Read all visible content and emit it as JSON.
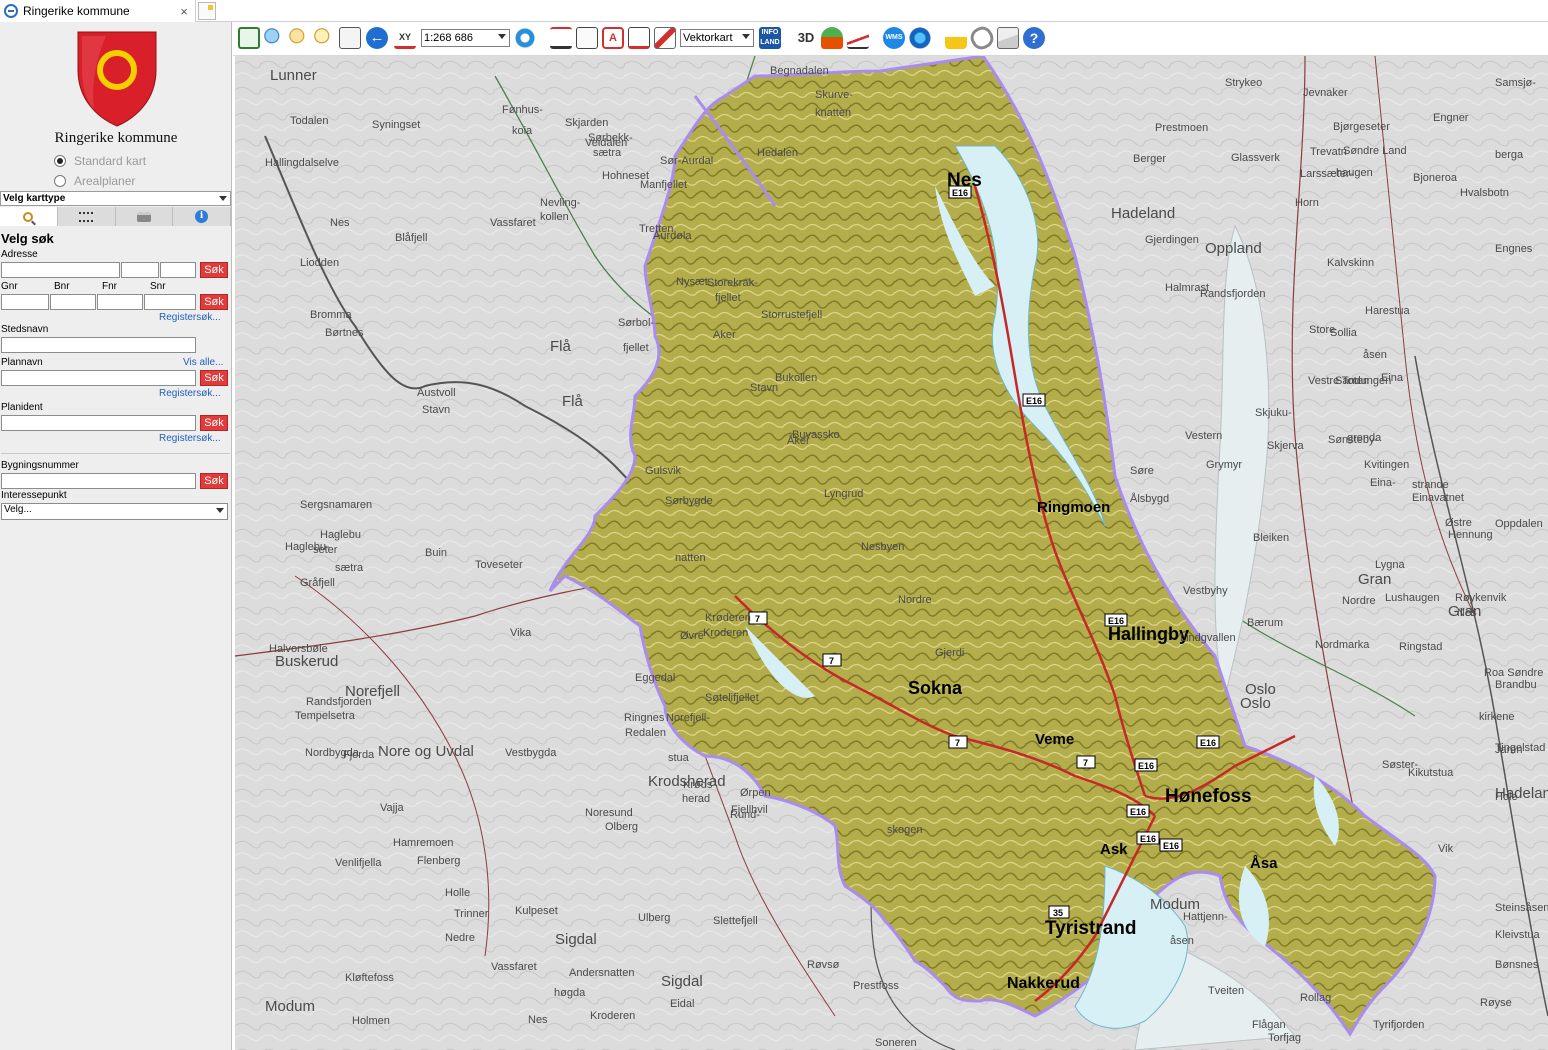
{
  "browser": {
    "tab_title": "Ringerike kommune",
    "tab_close": "×",
    "tab_icon": "ie-page-icon",
    "newtab_icon": "new-tab-icon"
  },
  "sidebar": {
    "municipality_name": "Ringerike kommune",
    "map_modes": [
      {
        "label": "Standard kart",
        "selected": true
      },
      {
        "label": "Arealplaner",
        "selected": false
      }
    ],
    "map_type_select": "Velg karttype",
    "tool_tabs": [
      "search-icon",
      "layers-icon",
      "print-icon",
      "info-icon"
    ],
    "search": {
      "heading": "Velg søk",
      "address_label": "Adresse",
      "search_button": "Søk",
      "gnr_label": "Gnr",
      "bnr_label": "Bnr",
      "fnr_label": "Fnr",
      "snr_label": "Snr",
      "register_link": "Registersøk...",
      "place_label": "Stedsnavn",
      "plan_label": "Plannavn",
      "show_all_link": "Vis alle...",
      "planident_label": "Planident",
      "building_label": "Bygningsnummer",
      "poi_label": "Interessepunkt",
      "poi_select": "Velg..."
    }
  },
  "toolbar": {
    "scale": "1:268 686",
    "map_type": "Vektorkart",
    "icons": [
      "zoom-extent-icon",
      "zoom-in-icon",
      "zoom-out-icon",
      "zoom-search-icon",
      "select-area-icon",
      "back-icon",
      "coordinate-icon",
      "refresh-icon",
      "measure-icon",
      "buildings-icon",
      "address-icon",
      "property-icon",
      "draw-icon",
      "info-land-icon",
      "3d-icon",
      "poi-icon",
      "profile-icon",
      "wms-icon",
      "globe-icon",
      "lock-icon",
      "link-icon",
      "mail-icon",
      "help-icon"
    ],
    "xy_label": "XY",
    "infoland_label": "INFO LAND",
    "wms_label": "WMS",
    "help_label": "?"
  },
  "map": {
    "colors": {
      "municipality_fill": "#b6ae4e",
      "boundary": "#a98cf0",
      "water": "#d7f0f6",
      "roads": "#c62828",
      "background": "#dcdcdc"
    },
    "major_places": [
      "Nes",
      "Ringmoen",
      "Hallingby",
      "Sokna",
      "Veme",
      "Hønefoss",
      "Ask",
      "Åsa",
      "Tyristrand",
      "Nakkerud"
    ],
    "road_shields": [
      "E16",
      "E16",
      "E16",
      "7",
      "7",
      "7",
      "7",
      "E16",
      "E16",
      "E16",
      "E16",
      "E16",
      "35"
    ],
    "background_places": [
      "Begnadalen",
      "Todalen",
      "Syningset",
      "Fønhus-",
      "koia",
      "Skurve-",
      "knatten",
      "Sørbekk-",
      "sætra",
      "Sør-Aurdal",
      "Manfjellet",
      "Hedalen",
      "Nevling-",
      "kollen",
      "Vassfaret",
      "Hallingdalselve",
      "Nes",
      "Blåfjell",
      "Liodden",
      "Bromma",
      "Børtnes",
      "Flå",
      "Aurdøla",
      "Storekrak-",
      "fjellet",
      "Sørbol-",
      "fjellet",
      "Storrustefjell",
      "Bukollen",
      "Buvassko",
      "Austvoll",
      "Stavn",
      "Flå",
      "Gulsvik",
      "Sørbygde",
      "Sergsnamaren",
      "Haglebu",
      "seter",
      "Haglebu-",
      "sætra",
      "Buin",
      "Toveseter",
      "Gråfjell",
      "natten",
      "Krøderen",
      "Kroderen",
      "Øvre",
      "Vika",
      "Buskerud",
      "Norefjell",
      "Tempelsetra",
      "Nordbygda",
      "Vestbygda",
      "Nore og Uvdal",
      "Eggedal",
      "Søtelifjellet",
      "Ringnes",
      "Redalen",
      "Norefjell-",
      "stua",
      "Ørpen",
      "Fjellhvil",
      "Krodsherad",
      "Krøds-",
      "herad",
      "Noresund",
      "Olberg",
      "Rund-",
      "skogen",
      "Hamremoen",
      "Holle",
      "Venlifjella",
      "Nedre",
      "Kulpeset",
      "Sigdal",
      "Andersnatten",
      "Ulberg",
      "Slettefjell",
      "Røvsø",
      "Sigdal",
      "Eidal",
      "høgda",
      "Kroderen",
      "Kløftefoss",
      "Modum",
      "Holmen",
      "Prestfoss",
      "Soneren",
      "Flågan",
      "Rollag",
      "Tveiten",
      "Torfjag",
      "Hattjenn-",
      "åsen",
      "Modum",
      "Tyrifjorden",
      "Røyse",
      "Bønsnes",
      "Kleivstua",
      "Steinsåsen",
      "Vik",
      "Hole",
      "Bærum",
      "Nordmarka",
      "Oslo",
      "Oslo",
      "Kikutstua",
      "Sandungen",
      "Store",
      "Strykeo",
      "Jevnaker",
      "Prestmoen",
      "Berger",
      "Hadeland",
      "Glassverk",
      "Gjerdingen",
      "Oppland",
      "Randsfjorden",
      "Halmrast",
      "Trevatn",
      "Søndre Land",
      "Larssæter-",
      "haugen",
      "Engner",
      "Bjoneroa",
      "Horn",
      "Kalvskinn",
      "Sollia",
      "Skjuku-",
      "åsen",
      "Eina",
      "Vestre Toten",
      "Sønsteby-",
      "grenda",
      "Kvitingen",
      "Eina-",
      "strande",
      "Einavatnet",
      "Østre",
      "Hennung",
      "Bleiken",
      "Gran",
      "Lygna",
      "Lushaugen",
      "Røykenvik",
      "Nes",
      "Gran",
      "Brandbu",
      "Tingelstad",
      "Jaren",
      "Hadeland",
      "Søster-",
      "kirkene",
      "Ringstad",
      "Søre",
      "Ålsbygd",
      "Grymyr",
      "Vestern",
      "Skjerva",
      "Nordre",
      "Oppdalen",
      "Roa Søndre",
      "Lunner",
      "Bjørgeseter",
      "Harestua",
      "Vestbyhy",
      "Veidalen",
      "Lindgvallen",
      "Hvalsbotn",
      "Samsjø-",
      "berga",
      "Engnes",
      "Halvorsbøle",
      "Randsfjorden",
      "Fjorda",
      "Vajja",
      "Flenberg",
      "Trinner",
      "Vassfaret",
      "Nes",
      "Skjarden",
      "Hohneset",
      "Tretten",
      "Nysæt",
      "Aker",
      "Stavn",
      "Åker",
      "Lyngrud",
      "Nesbyen",
      "Nordre",
      "Gjerdi"
    ]
  }
}
